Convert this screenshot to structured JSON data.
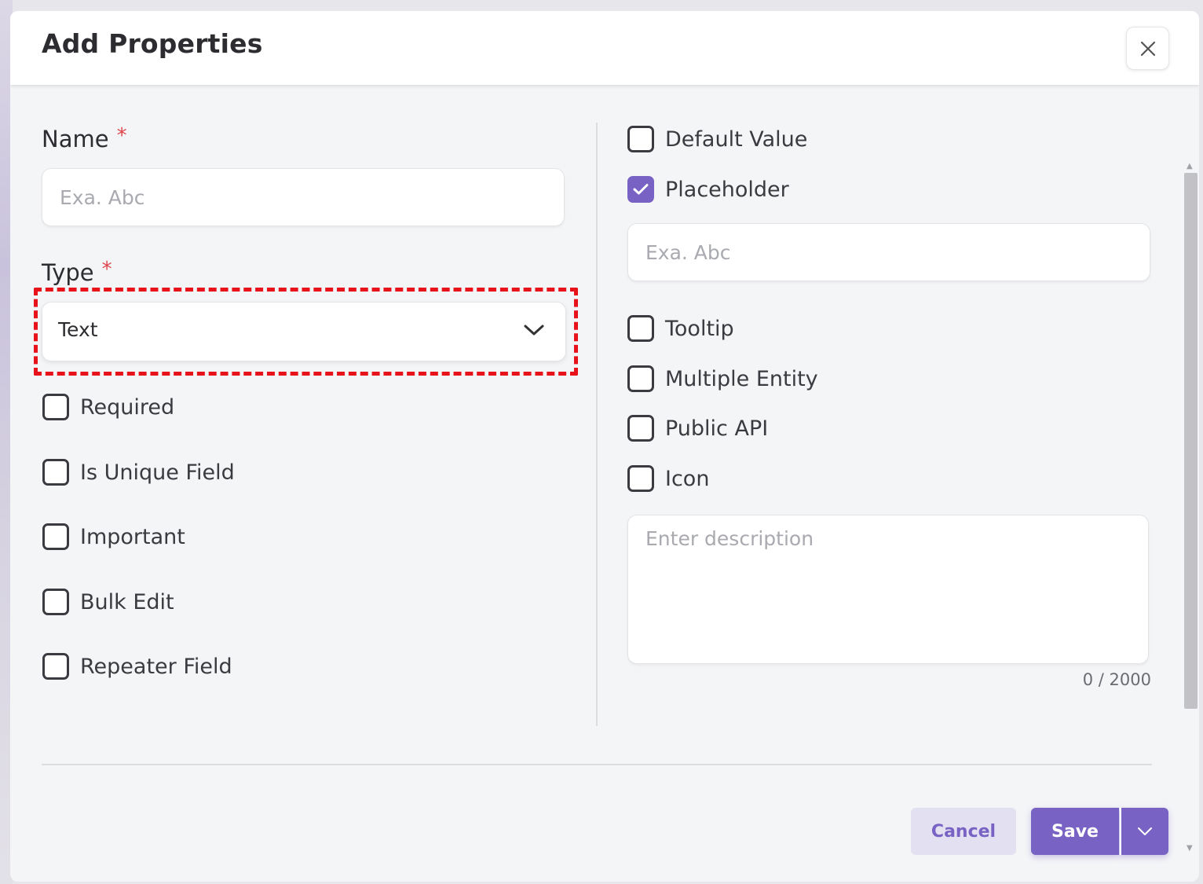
{
  "dialog": {
    "title": "Add Properties",
    "close_icon": "close-icon"
  },
  "form": {
    "name": {
      "label": "Name",
      "required_mark": "*",
      "placeholder": "Exa. Abc",
      "value": ""
    },
    "type": {
      "label": "Type",
      "required_mark": "*",
      "value": "Text",
      "icon": "chevron-down-icon"
    },
    "left_options": [
      {
        "label": "Required",
        "checked": false
      },
      {
        "label": "Is Unique Field",
        "checked": false
      },
      {
        "label": "Important",
        "checked": false
      },
      {
        "label": "Bulk Edit",
        "checked": false
      },
      {
        "label": "Repeater Field",
        "checked": false
      }
    ],
    "default_value": {
      "label": "Default Value",
      "checked": false
    },
    "placeholder_option": {
      "label": "Placeholder",
      "checked": true,
      "input_placeholder": "Exa. Abc"
    },
    "right_options": [
      {
        "label": "Tooltip",
        "checked": false
      },
      {
        "label": "Multiple Entity",
        "checked": false
      },
      {
        "label": "Public API",
        "checked": false
      },
      {
        "label": "Icon",
        "checked": false
      }
    ],
    "description": {
      "placeholder": "Enter description",
      "counter": "0 / 2000"
    }
  },
  "footer": {
    "cancel_label": "Cancel",
    "save_label": "Save",
    "split_icon": "chevron-down-icon"
  },
  "colors": {
    "accent": "#7863c4",
    "accent_light": "#e3e0f2",
    "required": "#e0474c",
    "highlight": "#e8121a"
  }
}
